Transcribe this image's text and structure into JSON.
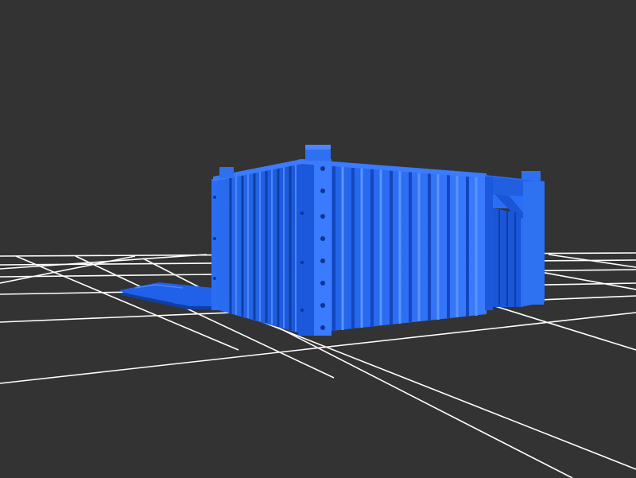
{
  "viewport": {
    "background_color": "#333333",
    "grid_color": "#ffffff",
    "model_color": "#1f5fe0",
    "model_highlight_color": "#3a7bff",
    "model_shadow_color": "#0f3fa6"
  },
  "scene": {
    "grid": "on",
    "model": "corrugated-shipping-container-with-open-door",
    "loose_part": "flat-panel-lying-on-floor"
  }
}
